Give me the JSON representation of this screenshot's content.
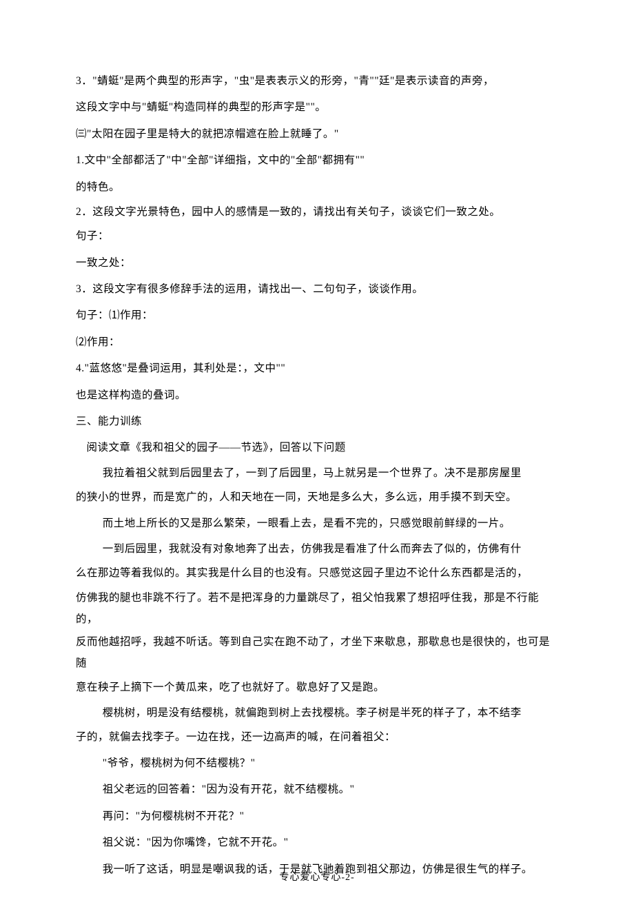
{
  "lines": {
    "l1": "3．\"蜻蜓\"是两个典型的形声字，\"虫\"是表表示义的形旁，\"青\"\"廷\"是表示读音的声旁，",
    "l2": "这段文字中与\"蜻蜓\"构造同样的典型的形声字是\"\"。",
    "l3": "㈢\"太阳在园子里是特大的就把凉帽遮在脸上就睡了。\"",
    "l4": "1.文中\"全部都活了\"中\"全部\"详细指，文中的\"全部\"都拥有\"\"",
    "l5": "的特色。",
    "l6": "2．这段文字光景特色，园中人的感情是一致的，请找出有关句子，谈谈它们一致之处。",
    "l6b": "句子：",
    "l7": "一致之处：",
    "l8": "3．这段文字有很多修辞手法的运用，请找出一、二句句子，谈谈作用。",
    "l9": "句子：⑴作用：",
    "l10": "⑵作用：",
    "l11": "4.\"蓝悠悠\"是叠词运用，其利处是：，文中\"\"",
    "l12": "也是这样构造的叠词。",
    "l13": "三、能力训练",
    "l14": "阅读文章《我和祖父的园子——节选》，回答以下问题",
    "l15": "我拉着祖父就到后园里去了，一到了后园里，马上就另是一个世界了。决不是那房屋里",
    "l16": "的狭小的世界，而是宽广的，人和天地在一同，天地是多么大，多么远，用手摸不到天空。",
    "l17": "而土地上所长的又是那么繁荣，一眼看上去，是看不完的，只感觉眼前鲜绿的一片。",
    "l18": "一到后园里，我就没有对象地奔了出去，仿佛我是看准了什么而奔去了似的，仿佛有什",
    "l19": "么在那边等着我似的。其实我是什么目的也没有。只感觉这园子里边不论什么东西都是活的，",
    "l20": "仿佛我的腿也非跳不行了。若不是把浑身的力量跳尽了，祖父怕我累了想招呼住我，那是不行能的，",
    "l21": "反而他越招呼，我越不听话。等到自己实在跑不动了，才坐下来歇息，那歇息也是很快的，也可是随",
    "l22": "意在秧子上摘下一个黄瓜来，吃了也就好了。歇息好了又是跑。",
    "l23": "樱桃树，明是没有结樱桃，就偏跑到树上去找樱桃。李子树是半死的样子了，本不结李",
    "l24": "子的，就偏去找李子。一边在找，还一边高声的喊，在问着祖父：",
    "l25": "\"爷爷，樱桃树为何不结樱桃？\"",
    "l26": "祖父老远的回答着：\"因为没有开花，就不结樱桃。\"",
    "l27": "再问：\"为何樱桃树不开花？\"",
    "l28": "祖父说：\"因为你嘴馋，它就不开花。\"",
    "l29": "我一听了这话，明显是嘲讽我的话，于是就飞驰着跑到祖父那边，仿佛是很生气的样子。"
  },
  "footer": "专心爱心专心-2-"
}
